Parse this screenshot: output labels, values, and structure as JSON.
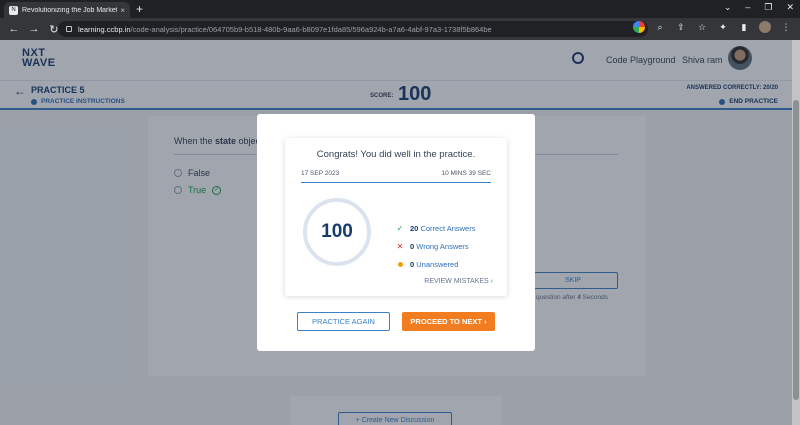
{
  "browser": {
    "tab_title": "Revolutionizing the Job Market |",
    "tab_close": "×",
    "new_tab": "+",
    "url_host": "learning.ccbp.in",
    "url_path": "/code-analysis/practice/064705b9-b518-480b-9aa6-b8097e1fda85/596a924b-a7a6-4abf-97a3-1738f5b864be"
  },
  "header": {
    "logo_line1": "NXT",
    "logo_line2": "WAVE",
    "playground": "Code Playground",
    "username": "Shiva ram"
  },
  "practice_bar": {
    "title": "PRACTICE 5",
    "instructions": "PRACTICE INSTRUCTIONS",
    "score_label": "SCORE:",
    "score_value": "100",
    "answered": "ANSWERED CORRECTLY: 20/20",
    "end_practice": "END PRACTICE"
  },
  "question": {
    "prefix": "When the ",
    "keyword": "state",
    "suffix": " objec",
    "options": [
      {
        "label": "False"
      },
      {
        "label": "True"
      }
    ],
    "skip_label": "SKIP",
    "skip_note_prefix": "question after ",
    "skip_note_seconds": "4",
    "skip_note_suffix": " Seconds"
  },
  "discussion": {
    "create_label": "+ Create New Discussion"
  },
  "modal": {
    "congrats": "Congrats! You did well in the practice.",
    "date": "17 SEP 2023",
    "duration": "10 MINS 39 SEC",
    "score": "100",
    "correct_count": "20",
    "correct_label": "Correct Answers",
    "wrong_count": "0",
    "wrong_label": "Wrong Answers",
    "unanswered_count": "0",
    "unanswered_label": "Unanswered",
    "review": "REVIEW MISTAKES",
    "practice_again": "PRACTICE AGAIN",
    "proceed": "PROCEED TO NEXT"
  },
  "colors": {
    "brand_navy": "#183b6e",
    "accent_blue": "#3b82c4",
    "proceed_orange": "#f27d21",
    "correct_green": "#16a34a",
    "wrong_red": "#dc2626",
    "unanswered_orange": "#f59e0b"
  },
  "icons": [
    "back-arrow-icon",
    "timer-icon",
    "check-icon",
    "cross-icon",
    "dot-icon",
    "chevron-right-icon"
  ]
}
